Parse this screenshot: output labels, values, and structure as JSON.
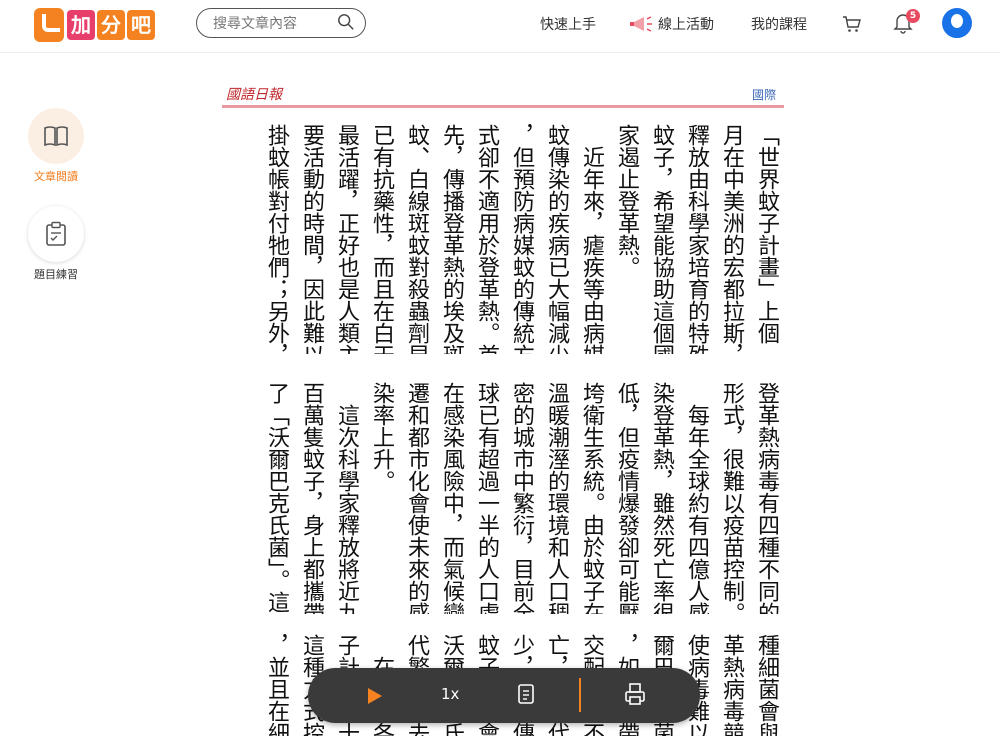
{
  "header": {
    "logo_chars": [
      "加",
      "分",
      "吧"
    ],
    "search_placeholder": "搜尋文章內容",
    "nav_quick": "快速上手",
    "nav_activity": "線上活動",
    "nav_course": "我的課程",
    "notification_count": "5"
  },
  "sidebar": {
    "items": [
      {
        "label": "文章閱讀",
        "icon": "book-icon",
        "active": true
      },
      {
        "label": "題目練習",
        "icon": "clipboard-icon",
        "active": false
      }
    ]
  },
  "article": {
    "masthead": "國語日報",
    "section": "國際",
    "block1": [
      "「世界蚊子計畫」上個",
      "月在中美洲的宏都拉斯，",
      "釋放由科學家培育的特殊",
      "蚊子，希望能協助這個國",
      "家遏止登革熱。",
      "　近年來，瘧疾等由病媒",
      "蚊傳染的疾病已大幅減少",
      "，但預防病媒蚊的傳統方",
      "式卻不適用於登革熱。首",
      "先，傳播登革熱的埃及斑",
      "蚊、白線斑蚊對殺蟲劑早",
      "已有抗藥性，而且在白天",
      "最活躍，正好也是人類主",
      "要活動的時間，因此難以",
      "掛蚊帳對付牠們；另外，"
    ],
    "block2": [
      "登革熱病毒有四種不同的",
      "形式，很難以疫苗控制。",
      "　每年全球約有四億人感",
      "染登革熱，雖然死亡率很",
      "低，但疫情爆發卻可能壓",
      "垮衛生系統。由於蚊子在",
      "溫暖潮溼的環境和人口稠",
      "密的城市中繁衍，目前全",
      "球已有超過一半的人口處",
      "在感染風險中，而氣候變",
      "遷和都市化會使未來的感",
      "染率上升。",
      "　這次科學家釋放將近九",
      "百萬隻蚊子，身上都攜帶",
      "了「沃爾巴克氏菌」。這"
    ],
    "block3": [
      "種細菌會與",
      "革熱病毒競",
      "使病毒難以",
      "爾巴克氏菌",
      "，如果未帶",
      "交配，卵不",
      "亡，下一代",
      "少，減少傳",
      "蚊子，則會",
      "沃爾巴克氏",
      "代繁殖下去",
      "　在世界各",
      "子計畫在十",
      "這種方式控",
      "，並且在細"
    ]
  },
  "player": {
    "speed": "1x"
  }
}
